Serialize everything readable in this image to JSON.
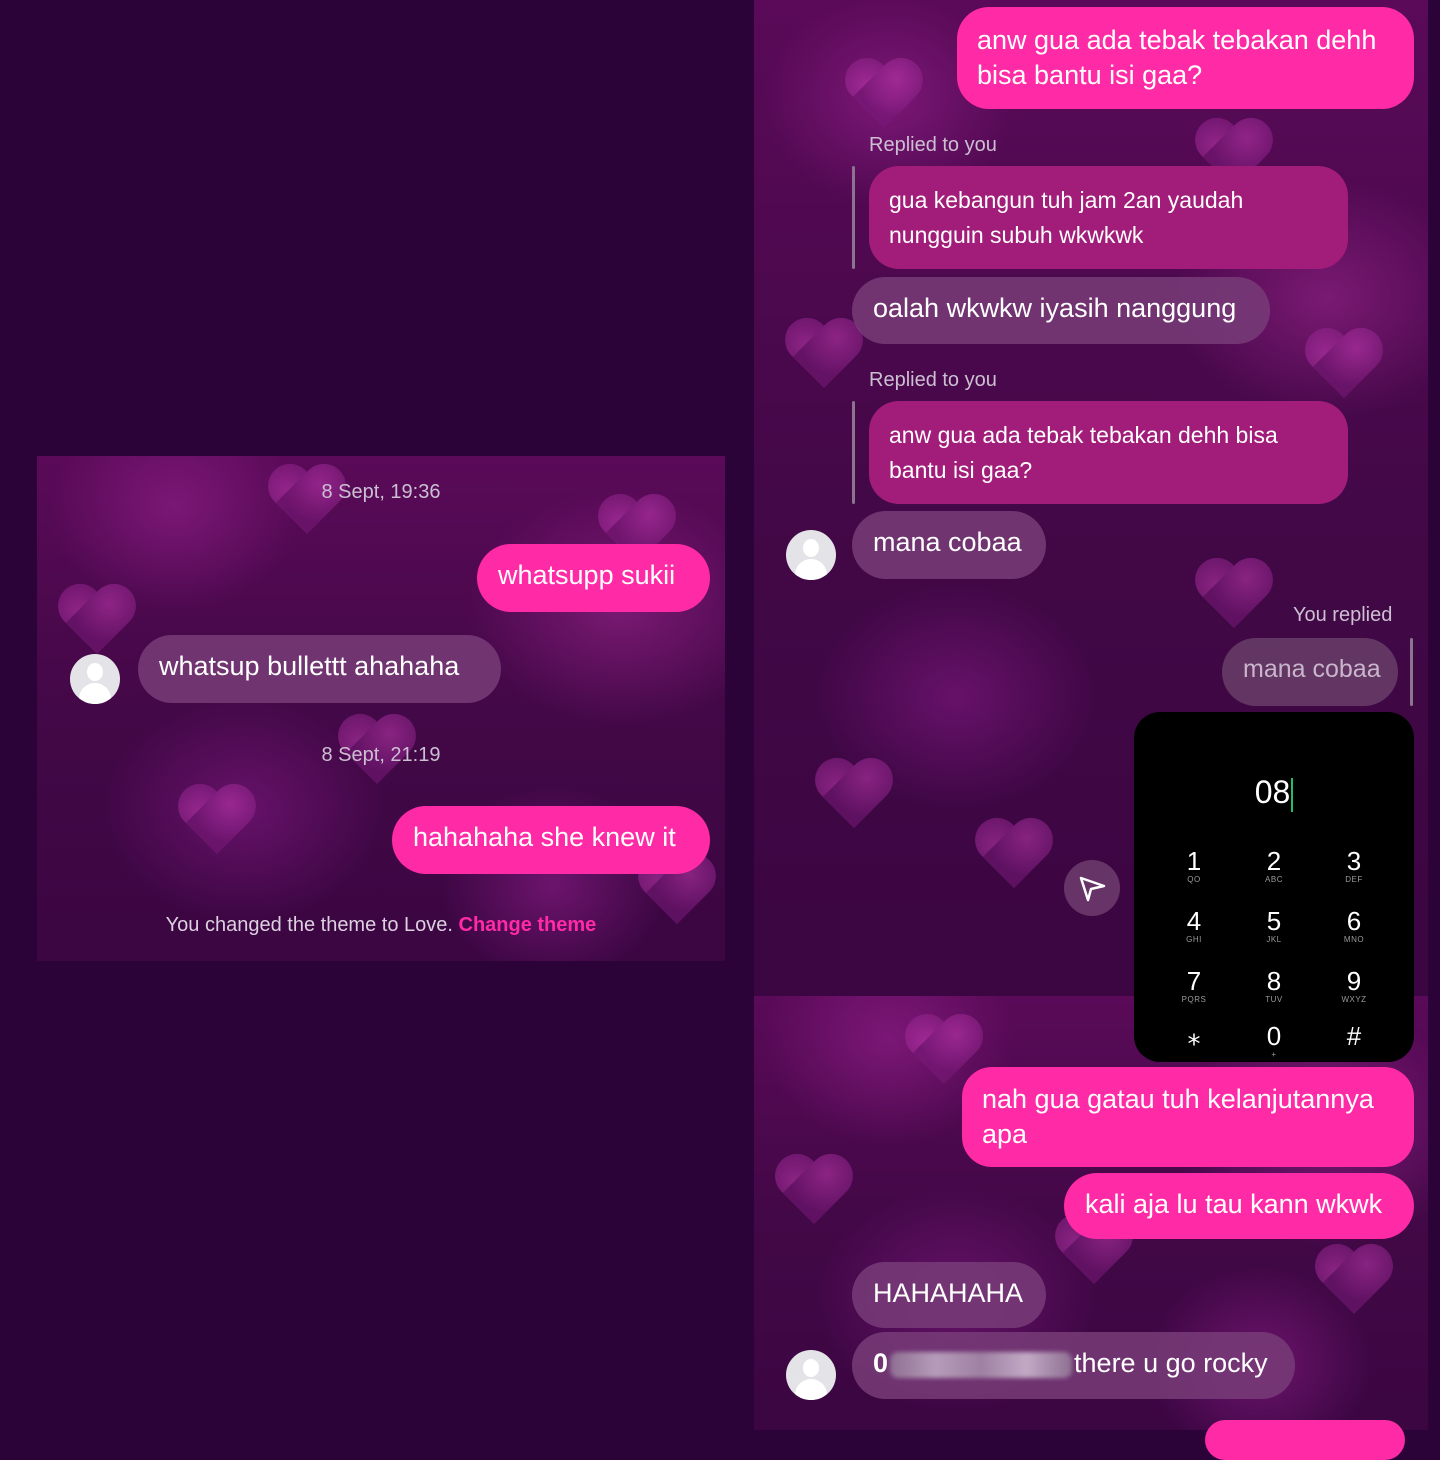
{
  "left_panel": {
    "timestamp_1": "8 Sept, 19:36",
    "msg_out_1": "whatsupp sukii",
    "msg_in_1": "whatsup bullettt ahahaha",
    "timestamp_2": "8 Sept, 21:19",
    "msg_out_2": "hahahaha she knew it",
    "theme_notice": "You changed the theme to Love.",
    "change_theme_link": "Change theme"
  },
  "right_panel": {
    "msg_out_top": "anw gua ada tebak tebakan dehh bisa bantu isi gaa?",
    "reply_label_1": "Replied to you",
    "quoted_1": "gua kebangun tuh jam 2an yaudah nungguin subuh wkwkwk",
    "msg_in_1": "oalah wkwkw iyasih nanggung",
    "reply_label_2": "Replied to you",
    "quoted_2": "anw gua ada tebak tebakan dehh bisa bantu isi gaa?",
    "msg_in_2": "mana cobaa",
    "you_replied_label": "You replied",
    "quoted_self": "mana cobaa",
    "dialer": {
      "number": "08",
      "keys": [
        {
          "digit": "1",
          "letters": "QO"
        },
        {
          "digit": "2",
          "letters": "ABC"
        },
        {
          "digit": "3",
          "letters": "DEF"
        },
        {
          "digit": "4",
          "letters": "GHI"
        },
        {
          "digit": "5",
          "letters": "JKL"
        },
        {
          "digit": "6",
          "letters": "MNO"
        },
        {
          "digit": "7",
          "letters": "PQRS"
        },
        {
          "digit": "8",
          "letters": "TUV"
        },
        {
          "digit": "9",
          "letters": "WXYZ"
        },
        {
          "digit": "⁎",
          "letters": ""
        },
        {
          "digit": "0",
          "letters": "+"
        },
        {
          "digit": "#",
          "letters": ""
        }
      ]
    },
    "msg_out_3": "nah gua gatau tuh kelanjutannya apa",
    "msg_out_4": "kali aja lu tau kann wkwk",
    "msg_in_3": "HAHAHAHA",
    "msg_in_4_prefix": "0",
    "msg_in_4_suffix": "there u go rocky"
  },
  "colors": {
    "outgoing_bubble": "#ff2aa5",
    "incoming_bubble": "#7a3c7a",
    "link": "#ff2aa5",
    "page_background": "#2b0338"
  },
  "icons": [
    "avatar-icon",
    "send-icon"
  ]
}
